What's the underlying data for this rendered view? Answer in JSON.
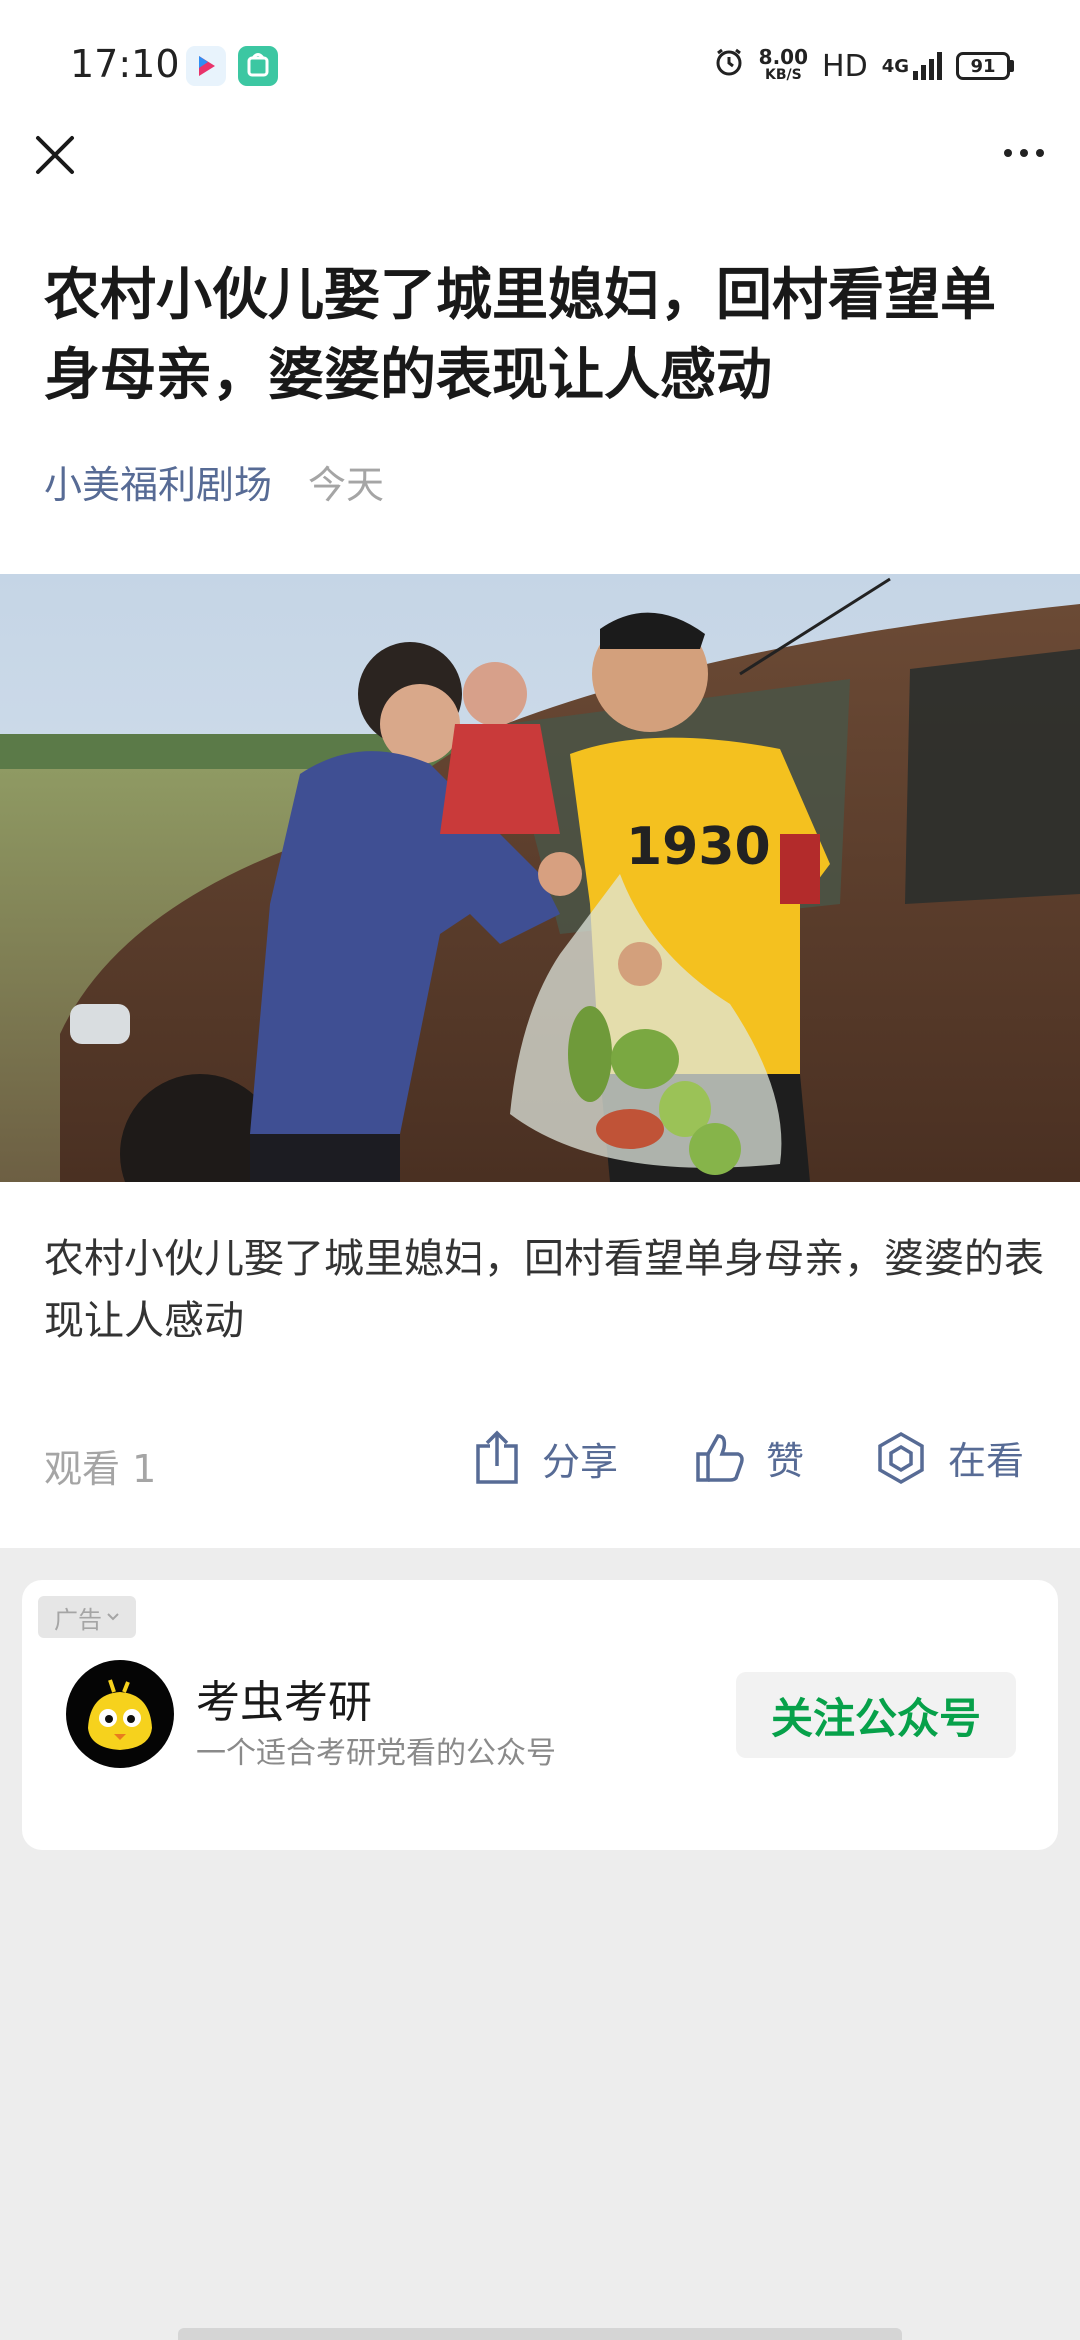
{
  "status_bar": {
    "time": "17:10",
    "net_speed_value": "8.00",
    "net_speed_unit": "KB/S",
    "hd": "HD",
    "network": "4G",
    "battery": "91"
  },
  "article": {
    "title": "农村小伙儿娶了城里媳妇，回村看望单身母亲，婆婆的表现让人感动",
    "author": "小美福利剧场",
    "date": "今天",
    "caption": "农村小伙儿娶了城里媳妇，回村看望单身母亲，婆婆的表现让人感动",
    "cover_jersey_text": "1930"
  },
  "actions": {
    "views": "观看 1",
    "share": "分享",
    "like": "赞",
    "watching": "在看"
  },
  "ad": {
    "tag": "广告",
    "name": "考虫考研",
    "description": "一个适合考研党看的公众号",
    "follow_button": "关注公众号"
  },
  "colors": {
    "link_blue": "#576b95",
    "follow_green": "#07a14a",
    "page_gray": "#ededed"
  }
}
